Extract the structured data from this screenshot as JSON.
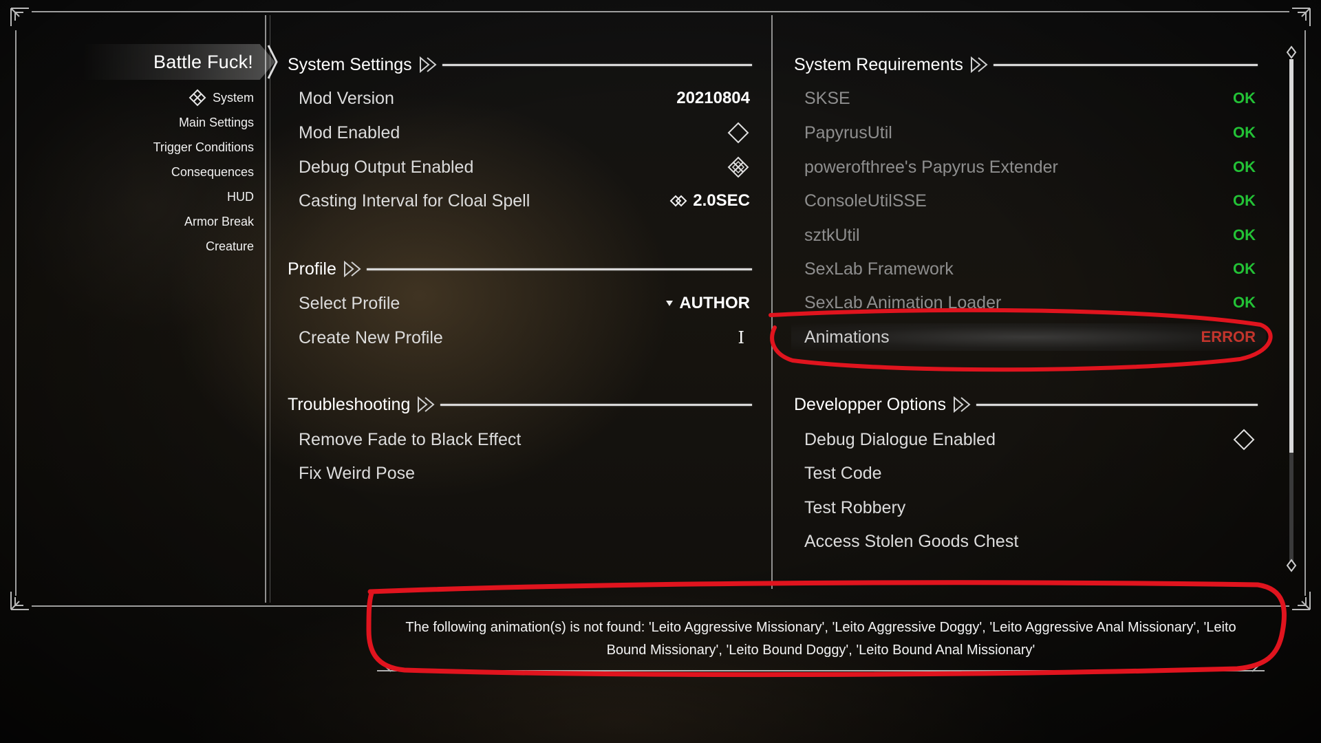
{
  "nav": {
    "title": "Battle Fuck!",
    "items": [
      {
        "label": "System",
        "icon": "circle-arrows-icon"
      },
      {
        "label": "Main Settings"
      },
      {
        "label": "Trigger Conditions"
      },
      {
        "label": "Consequences"
      },
      {
        "label": "HUD"
      },
      {
        "label": "Armor Break"
      },
      {
        "label": "Creature"
      }
    ]
  },
  "system_settings": {
    "header": "System Settings",
    "rows": [
      {
        "label": "Mod Version",
        "value": "20210804"
      },
      {
        "label": "Mod Enabled",
        "value_icon": "diamond-toggle-off-icon"
      },
      {
        "label": "Debug Output Enabled",
        "value_icon": "diamond-toggle-on-icon"
      },
      {
        "label": "Casting Interval for Cloal Spell",
        "value": "2.0SEC",
        "value_icon": "slider-arrows-icon"
      }
    ]
  },
  "profile": {
    "header": "Profile",
    "rows": [
      {
        "label": "Select Profile",
        "value": "AUTHOR",
        "value_icon": "dropdown-triangle-icon"
      },
      {
        "label": "Create New Profile",
        "value": "I",
        "value_icon": "text-cursor-icon"
      }
    ]
  },
  "troubleshooting": {
    "header": "Troubleshooting",
    "rows": [
      {
        "label": "Remove Fade to Black Effect"
      },
      {
        "label": "Fix Weird Pose"
      }
    ]
  },
  "system_requirements": {
    "header": "System Requirements",
    "rows": [
      {
        "label": "SKSE",
        "status": "OK"
      },
      {
        "label": "PapyrusUtil",
        "status": "OK"
      },
      {
        "label": "powerofthree's Papyrus Extender",
        "status": "OK"
      },
      {
        "label": "ConsoleUtilSSE",
        "status": "OK"
      },
      {
        "label": "sztkUtil",
        "status": "OK"
      },
      {
        "label": "SexLab Framework",
        "status": "OK"
      },
      {
        "label": "SexLab Animation Loader",
        "status": "OK"
      },
      {
        "label": "Animations",
        "status": "ERROR"
      }
    ]
  },
  "developer_options": {
    "header": "Developper Options",
    "rows": [
      {
        "label": "Debug Dialogue Enabled",
        "value_icon": "diamond-toggle-off-icon"
      },
      {
        "label": "Test Code"
      },
      {
        "label": "Test Robbery"
      },
      {
        "label": "Access Stolen Goods Chest"
      }
    ]
  },
  "info_text": "The following animation(s) is not found: 'Leito Aggressive Missionary', 'Leito Aggressive Doggy', 'Leito Aggressive Anal Missionary', 'Leito Bound Missionary', 'Leito Bound Doggy', 'Leito Bound Anal Missionary'",
  "colors": {
    "ok": "#23c236",
    "error": "#c4352c",
    "annotation": "#e0141e"
  }
}
